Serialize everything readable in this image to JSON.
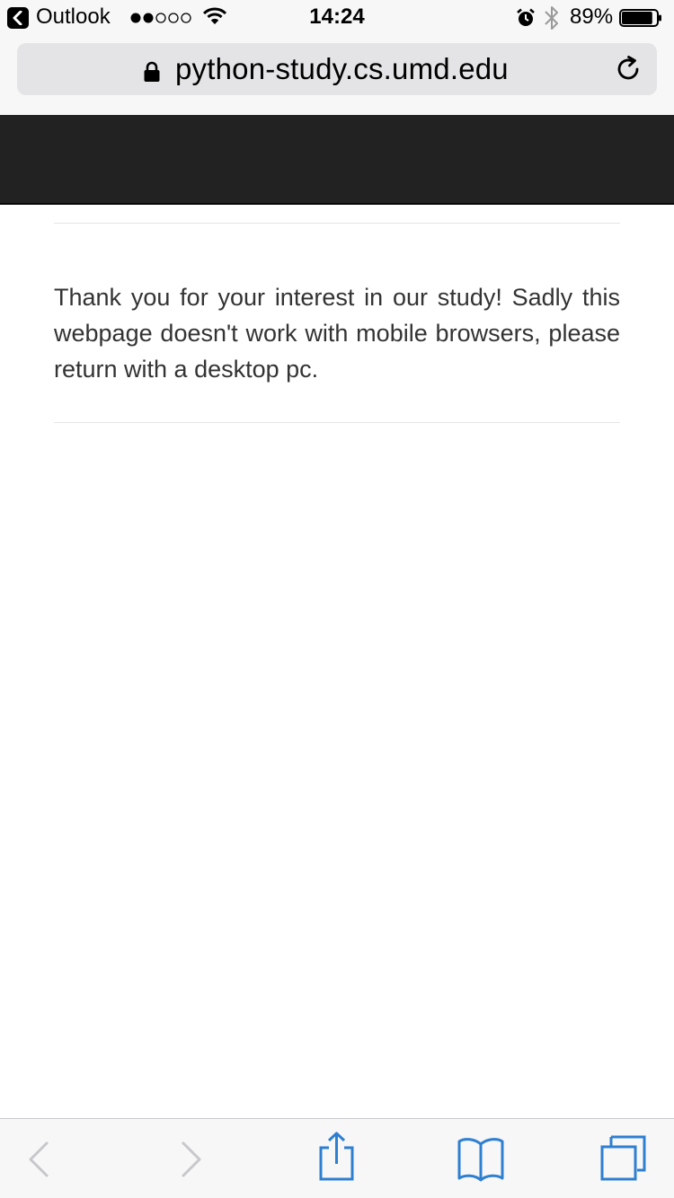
{
  "status_bar": {
    "back_app": "Outlook",
    "time": "14:24",
    "battery_percent": "89%",
    "signal_bars": 2,
    "signal_total": 5,
    "battery_level": 0.89
  },
  "browser": {
    "url": "python-study.cs.umd.edu",
    "icons": {
      "lock": "lock-icon",
      "reload": "reload-icon"
    }
  },
  "page": {
    "message": "Thank you for your interest in our study! Sadly this webpage doesn't work with mobile browsers, please return with a desktop pc."
  },
  "toolbar": {
    "icons": [
      "back-icon",
      "forward-icon",
      "share-icon",
      "bookmarks-icon",
      "tabs-icon"
    ],
    "accent_color": "#2f7fd1",
    "disabled_color": "#c7c7cc"
  },
  "colors": {
    "header_dark": "#222222",
    "text": "#333333",
    "chrome_bg": "#f7f7f7"
  }
}
